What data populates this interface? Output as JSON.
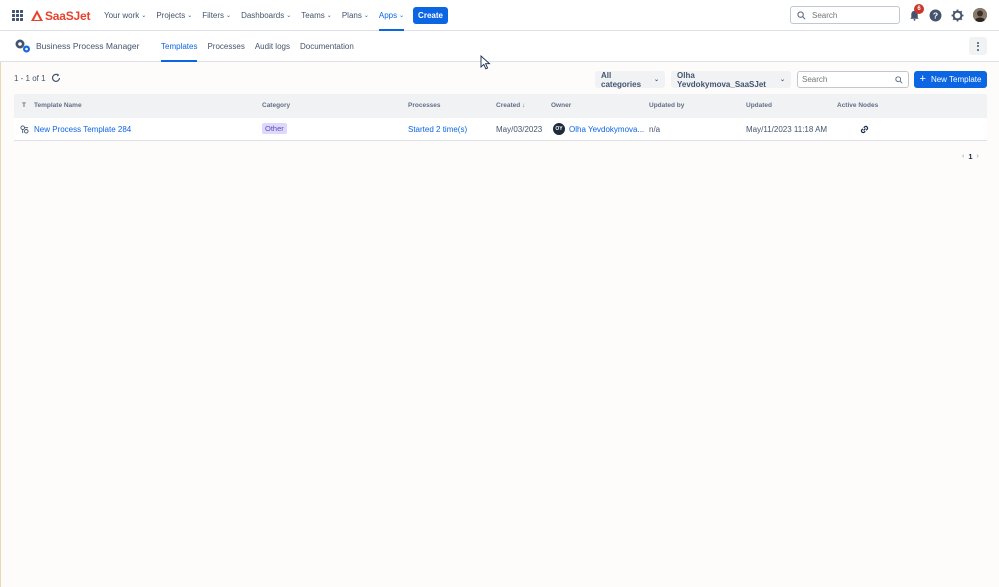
{
  "topnav": {
    "logo_text": "SaaSJet",
    "items": [
      {
        "label": "Your work"
      },
      {
        "label": "Projects"
      },
      {
        "label": "Filters"
      },
      {
        "label": "Dashboards"
      },
      {
        "label": "Teams"
      },
      {
        "label": "Plans"
      },
      {
        "label": "Apps",
        "active": true
      }
    ],
    "create_label": "Create",
    "search_placeholder": "Search",
    "notifications_count": "6"
  },
  "app": {
    "name": "Business Process Manager",
    "tabs": [
      {
        "label": "Templates",
        "active": true
      },
      {
        "label": "Processes"
      },
      {
        "label": "Audit logs"
      },
      {
        "label": "Documentation"
      }
    ]
  },
  "toolbar": {
    "count": "1 - 1 of 1",
    "category_select": "All categories",
    "user_select": "Olha Yevdokymova_SaaSJet",
    "search_placeholder": "Search",
    "new_template_label": "New Template"
  },
  "table": {
    "columns": {
      "type": "T",
      "name": "Template Name",
      "category": "Category",
      "processes": "Processes",
      "created": "Created ↓",
      "owner": "Owner",
      "updated_by": "Updated by",
      "updated": "Updated",
      "active_nodes": "Active Nodes"
    },
    "rows": [
      {
        "name": "New Process Template 284",
        "category": "Other",
        "processes": "Started 2 time(s)",
        "created": "May/03/2023",
        "owner_initials": "OY",
        "owner": "Olha Yevdokymova...",
        "updated_by": "n/a",
        "updated": "May/11/2023 11:18 AM"
      }
    ]
  },
  "pager": {
    "prev": "‹",
    "current": "1",
    "next": "›"
  },
  "colors": {
    "accent": "#0c66e4",
    "brand": "#e8412c",
    "badge_bg": "#dfd8fd"
  }
}
